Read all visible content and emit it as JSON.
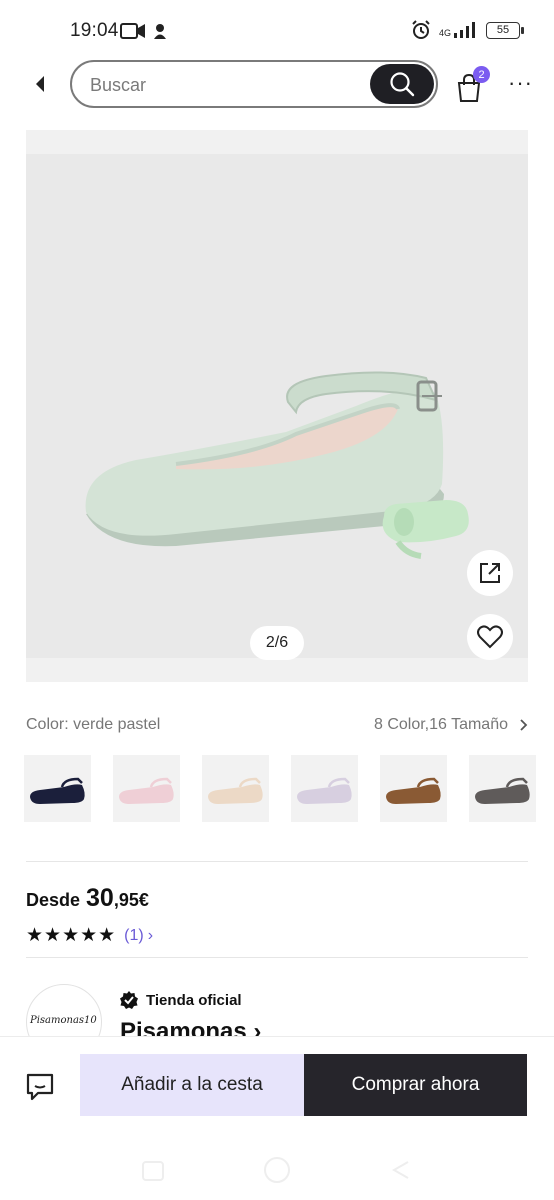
{
  "status_bar": {
    "time": "19:04",
    "network": "4G",
    "battery": "55"
  },
  "header": {
    "search_placeholder": "Buscar",
    "cart_count": "2",
    "more_label": "···"
  },
  "gallery": {
    "page_indicator": "2/6",
    "product_color_hex": "#d4e3d6",
    "background_hex": "#e9e9e9"
  },
  "variants": {
    "color_label": "Color: verde pastel",
    "variants_summary": "8 Color,16 Tamaño",
    "swatches": [
      {
        "name": "navy",
        "color": "#1b1f3b"
      },
      {
        "name": "pink",
        "color": "#efcfd6"
      },
      {
        "name": "beige",
        "color": "#ecd9c6"
      },
      {
        "name": "lilac",
        "color": "#d7cfe0"
      },
      {
        "name": "brown",
        "color": "#8a5a34"
      },
      {
        "name": "grey",
        "color": "#5f5b5a"
      }
    ]
  },
  "price": {
    "prefix": "Desde",
    "integer": "30",
    "decimal": ",95€"
  },
  "rating": {
    "stars": "★★★★★",
    "count": "(1)",
    "chevron": "›"
  },
  "store": {
    "logo_text": "Pisamonas10",
    "official_label": "Tienda oficial",
    "name": "Pisamonas ›"
  },
  "actions": {
    "add_to_cart": "Añadir a la cesta",
    "buy_now": "Comprar ahora"
  },
  "colors": {
    "accent": "#7b5cf0",
    "rating_link": "#6b5bd6",
    "buy_button": "#26252b",
    "add_button": "#e7e4fb"
  }
}
